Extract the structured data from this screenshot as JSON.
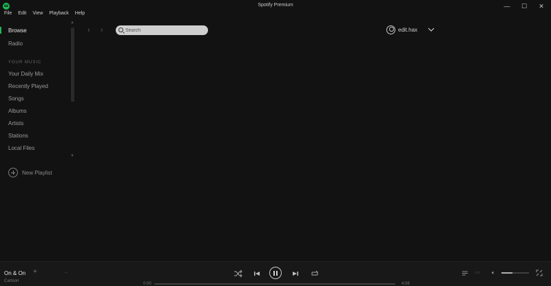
{
  "window": {
    "title": "Spotify Premium",
    "controls": {
      "minimize": "—",
      "maximize": "☐",
      "close": "✕"
    }
  },
  "menu": [
    "File",
    "Edit",
    "View",
    "Playback",
    "Help"
  ],
  "sidebar": {
    "items": [
      {
        "label": "Browse",
        "active": true
      },
      {
        "label": "Radio",
        "active": false
      }
    ],
    "section_label": "YOUR MUSIC",
    "library": [
      "Your Daily Mix",
      "Recently Played",
      "Songs",
      "Albums",
      "Artists",
      "Stations",
      "Local Files"
    ],
    "new_playlist": "New Playlist"
  },
  "topbar": {
    "search_placeholder": "Search",
    "username": "edit.hax"
  },
  "player": {
    "track": "On & On",
    "artist": "Cartoon",
    "elapsed": "0:00",
    "duration": "4:08",
    "progress_fraction": 0,
    "volume_fraction": 0.4,
    "shuffle_icon": "shuffle-icon",
    "playing": true
  },
  "colors": {
    "accent": "#1db954",
    "background": "#121212",
    "player_bg": "#181818"
  }
}
